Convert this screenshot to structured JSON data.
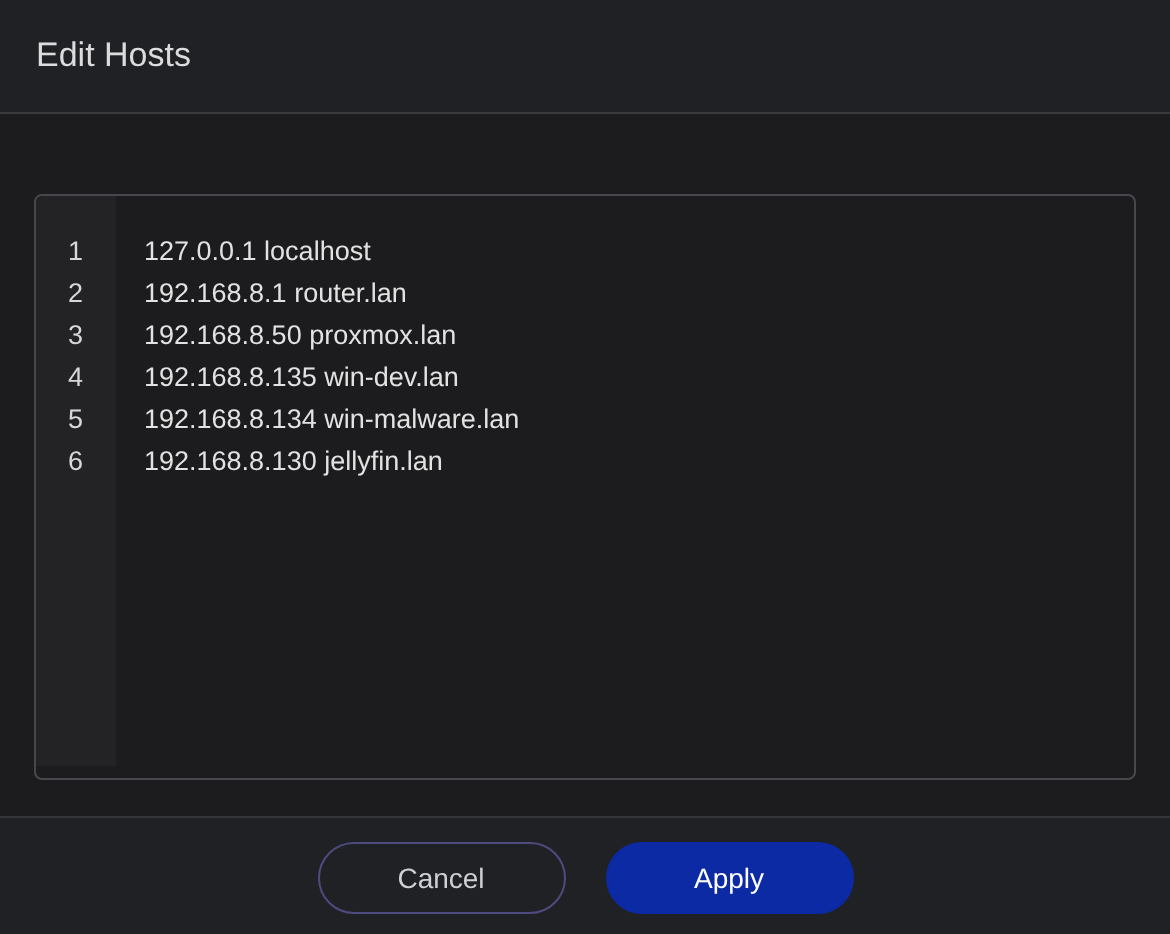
{
  "dialog": {
    "title": "Edit Hosts"
  },
  "editor": {
    "lines": [
      {
        "number": "1",
        "text": "127.0.0.1 localhost"
      },
      {
        "number": "2",
        "text": "192.168.8.1 router.lan"
      },
      {
        "number": "3",
        "text": "192.168.8.50 proxmox.lan"
      },
      {
        "number": "4",
        "text": "192.168.8.135 win-dev.lan"
      },
      {
        "number": "5",
        "text": "192.168.8.134 win-malware.lan"
      },
      {
        "number": "6",
        "text": "192.168.8.130 jellyfin.lan"
      }
    ]
  },
  "buttons": [
    {
      "label": "Cancel",
      "kind": "secondary"
    },
    {
      "label": "Apply",
      "kind": "primary"
    }
  ]
}
